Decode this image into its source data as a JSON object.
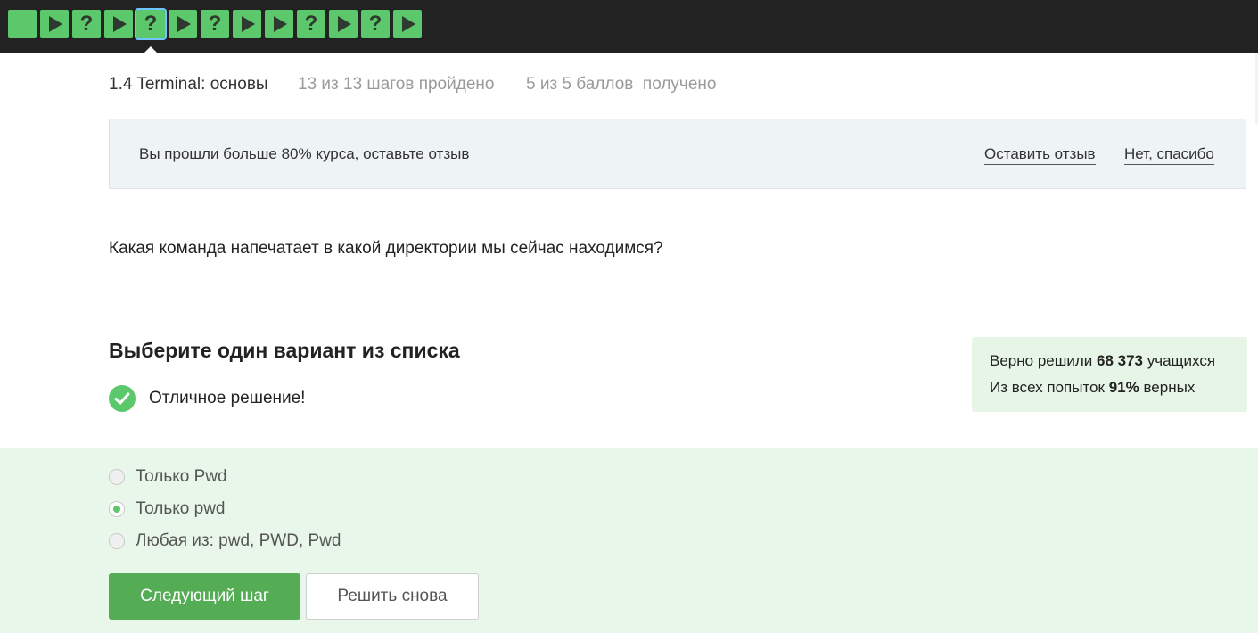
{
  "steps": [
    {
      "kind": "text",
      "icon": "blank-icon"
    },
    {
      "kind": "video",
      "icon": "play-icon"
    },
    {
      "kind": "quiz",
      "icon": "question-icon",
      "label": "?"
    },
    {
      "kind": "video",
      "icon": "play-icon"
    },
    {
      "kind": "quiz",
      "icon": "question-icon",
      "label": "?",
      "current": true
    },
    {
      "kind": "video",
      "icon": "play-icon"
    },
    {
      "kind": "quiz",
      "icon": "question-icon",
      "label": "?"
    },
    {
      "kind": "video",
      "icon": "play-icon"
    },
    {
      "kind": "video",
      "icon": "play-icon"
    },
    {
      "kind": "quiz",
      "icon": "question-icon",
      "label": "?"
    },
    {
      "kind": "video",
      "icon": "play-icon"
    },
    {
      "kind": "quiz",
      "icon": "question-icon",
      "label": "?"
    },
    {
      "kind": "video",
      "icon": "play-icon"
    }
  ],
  "lesson": {
    "title": "1.4 Terminal: основы",
    "progress": "13 из 13 шагов пройдено",
    "score": "5 из 5 баллов  получено"
  },
  "feedback_banner": {
    "text": "Вы прошли больше 80% курса, оставьте отзыв",
    "leave_review": "Оставить отзыв",
    "no_thanks": "Нет, спасибо"
  },
  "question": "Какая команда напечатает в какой директории мы сейчас находимся?",
  "choose_title": "Выберите один вариант из списка",
  "result": {
    "text": "Отличное решение!",
    "icon": "check-circle-icon"
  },
  "stats": {
    "solved_prefix": "Верно решили ",
    "solved_count": "68 373",
    "solved_suffix": " учащихся",
    "attempts_prefix": "Из всех попыток ",
    "attempts_percent": "91%",
    "attempts_suffix": " верных"
  },
  "options": [
    {
      "label": "Только Pwd",
      "selected": false
    },
    {
      "label": "Только pwd",
      "selected": true
    },
    {
      "label": "Любая из: pwd, PWD, Pwd",
      "selected": false
    }
  ],
  "buttons": {
    "next": "Следующий шаг",
    "retry": "Решить снова"
  },
  "colors": {
    "accent_green": "#5bc96b",
    "button_green": "#54ad54",
    "topbar": "#222222",
    "answer_bg": "#e8f7e9"
  }
}
